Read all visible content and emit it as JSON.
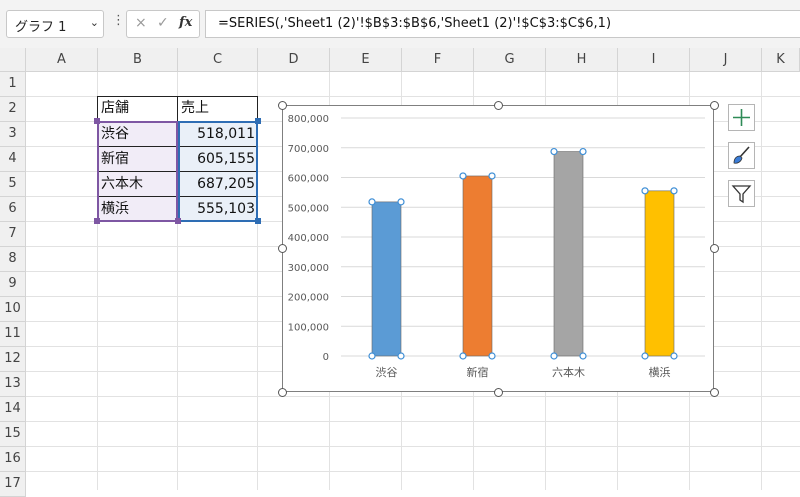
{
  "name_box": {
    "value": "グラフ 1"
  },
  "formula_bar": {
    "value": "=SERIES(,'Sheet1 (2)'!$B$3:$B$6,'Sheet1 (2)'!$C$3:$C$6,1)",
    "cancel_icon": "×",
    "enter_icon": "✓",
    "fx_label": "fx"
  },
  "columns": [
    "A",
    "B",
    "C",
    "D",
    "E",
    "F",
    "G",
    "H",
    "I",
    "J",
    "K"
  ],
  "rows": [
    "1",
    "2",
    "3",
    "4",
    "5",
    "6",
    "7",
    "8",
    "9",
    "10",
    "11",
    "12",
    "13",
    "14",
    "15",
    "16",
    "17"
  ],
  "table": {
    "headers": [
      "店舗",
      "売上"
    ],
    "rows": [
      {
        "store": "渋谷",
        "sales": "518,011"
      },
      {
        "store": "新宿",
        "sales": "605,155"
      },
      {
        "store": "六本木",
        "sales": "687,205"
      },
      {
        "store": "横浜",
        "sales": "555,103"
      }
    ]
  },
  "chart_data": {
    "type": "bar",
    "categories": [
      "渋谷",
      "新宿",
      "六本木",
      "横浜"
    ],
    "values": [
      518011,
      605155,
      687205,
      555103
    ],
    "colors": [
      "#5b9bd5",
      "#ed7d31",
      "#a5a5a5",
      "#ffc000"
    ],
    "ylim": [
      0,
      800000
    ],
    "yticks": [
      "0",
      "100,000",
      "200,000",
      "300,000",
      "400,000",
      "500,000",
      "600,000",
      "700,000",
      "800,000"
    ],
    "grid": true
  },
  "side_buttons": [
    {
      "icon": "plus-icon"
    },
    {
      "icon": "brush-icon"
    },
    {
      "icon": "filter-icon"
    }
  ]
}
